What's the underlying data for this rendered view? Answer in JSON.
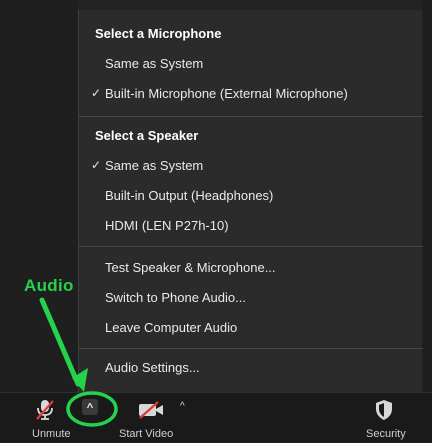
{
  "menu": {
    "microphone_header": "Select a Microphone",
    "mic_items": [
      {
        "label": "Same as System",
        "checked": false
      },
      {
        "label": "Built-in Microphone (External Microphone)",
        "checked": true
      }
    ],
    "speaker_header": "Select a Speaker",
    "speaker_items": [
      {
        "label": "Same as System",
        "checked": true
      },
      {
        "label": "Built-in Output (Headphones)",
        "checked": false
      },
      {
        "label": "HDMI (LEN P27h-10)",
        "checked": false
      }
    ],
    "actions": [
      "Test Speaker & Microphone...",
      "Switch to Phone Audio...",
      "Leave Computer Audio"
    ],
    "audio_settings": "Audio Settings...",
    "check_glyph": "✓"
  },
  "toolbar": {
    "unmute_label": "Unmute",
    "start_video_label": "Start Video",
    "security_label": "Security",
    "caret_glyph": "^"
  },
  "annotation": {
    "label": "Audio",
    "color": "#26d14c"
  },
  "colors": {
    "menu_bg": "#2b2b2b",
    "toolbar_bg": "#1a1a1a",
    "accent_green": "#26d14c",
    "muted_red": "#e23b3b"
  },
  "icons": {
    "unmute": "microphone-muted-icon",
    "audio_options": "chevron-up-icon",
    "start_video": "video-camera-off-icon",
    "security": "shield-icon",
    "check": "checkmark-icon"
  }
}
